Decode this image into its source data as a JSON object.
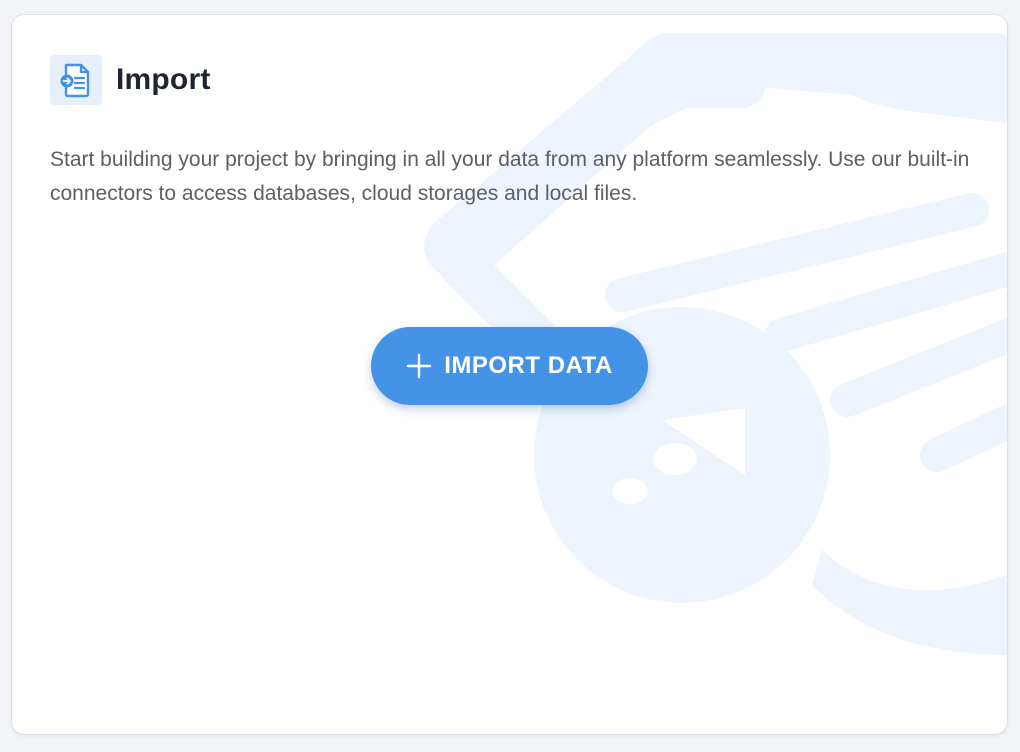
{
  "card": {
    "title": "Import",
    "description": "Start building your project by bringing in all your data from any platform seamlessly. Use our built-in connectors to access databases, cloud storages and local files.",
    "import_button_label": "IMPORT DATA"
  },
  "icons": {
    "header": "import-document-icon",
    "button": "plus-icon",
    "background": "import-illustration"
  },
  "colors": {
    "accent": "#4593e6",
    "icon_bg": "#e6f0fc",
    "illustration": "#edf4fd",
    "title": "#1f2430",
    "body_text": "#5b5f66"
  }
}
